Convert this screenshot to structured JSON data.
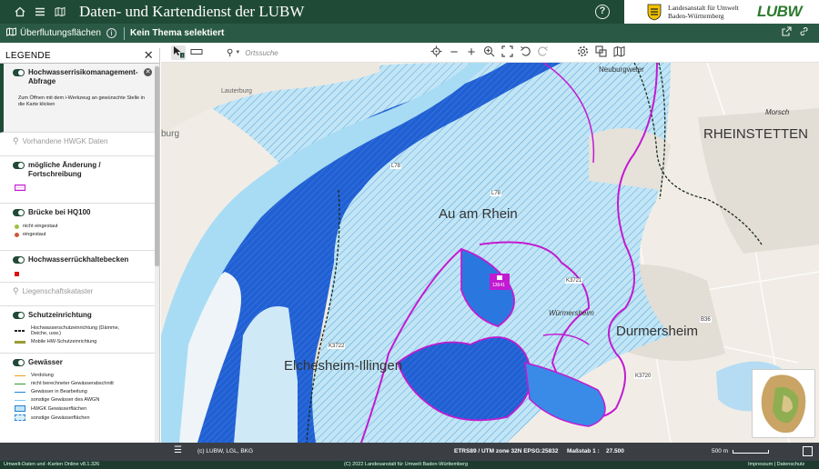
{
  "app": {
    "title": "Daten- und Kartendienst der LUBW",
    "org_name": "Landesanstalt für Umwelt Baden-Württemberg",
    "logo_text": "LUBW"
  },
  "subbar": {
    "layer_label": "Überflutungsflächen",
    "theme_label": "Kein Thema selektiert"
  },
  "legend": {
    "title": "LEGENDE",
    "sections": [
      {
        "name": "Hochwasserrisikomanagement-Abfrage",
        "note": "Zum Öffnen mit dem i-Werkzeug an gewünschte Stelle in die Karte klicken"
      },
      {
        "name": "Vorhandene HWGK Daten"
      },
      {
        "name": "mögliche Änderung / Fortschreibung"
      },
      {
        "name": "Brücke bei HQ100",
        "items": [
          "nicht eingestaut",
          "eingestaut"
        ]
      },
      {
        "name": "Hochwasserrückhaltebecken"
      },
      {
        "name": "Liegenschaftskataster"
      },
      {
        "name": "Schutzeinrichtung",
        "items": [
          "Hochwasserschutzeinrichtung (Dämme, Deiche, usw.)",
          "Mobile HW-Schutzeinrichtung"
        ]
      },
      {
        "name": "Gewässer",
        "items": [
          "Verdolung",
          "nicht berechneter Gewässerabschnitt",
          "Gewässer in Bearbeitung",
          "sonstige Gewässer des AWGN",
          "HWGK Gewässerflächen",
          "sonstige Gewässerflächen"
        ]
      }
    ]
  },
  "toolbar": {
    "search_placeholder": "Ortssuche"
  },
  "map": {
    "labels": {
      "au": "Au am Rhein",
      "durmersheim": "Durmersheim",
      "rheinstetten": "RHEINSTETTEN",
      "elchesheim": "Elchesheim-Illingen",
      "wuermersheim": "Würmersheim",
      "neuburgweier": "Neuburgweier",
      "morsch": "Morsch",
      "lauterburg": "Lauterburg",
      "burg": "burg",
      "marker": "13641",
      "road_l78": "L78",
      "road_k3721": "K3721",
      "road_k3722": "K3722",
      "road_k3720": "K3720",
      "road_b36": "B36",
      "road_l78b": "L78"
    }
  },
  "mapbar": {
    "copyright": "(c) LUBW, LGL, BKG",
    "crs": "ETRS89 / UTM zone 32N EPSG:25832",
    "scale_label": "Maßstab 1 :",
    "scale_value": "27.500",
    "scalebar_label": "500 m"
  },
  "status": {
    "version": "Umwelt-Daten und -Karten Online v8.1.326",
    "copyright": "(C) 2022 Landesanstalt für Umwelt Baden-Württemberg",
    "links": "Impressum | Datenschutz"
  },
  "colors": {
    "header": "#1f4a36",
    "river_dark": "#1f5fd6",
    "flood_light": "#b9e3f6",
    "boundary_magenta": "#c21bd1"
  }
}
